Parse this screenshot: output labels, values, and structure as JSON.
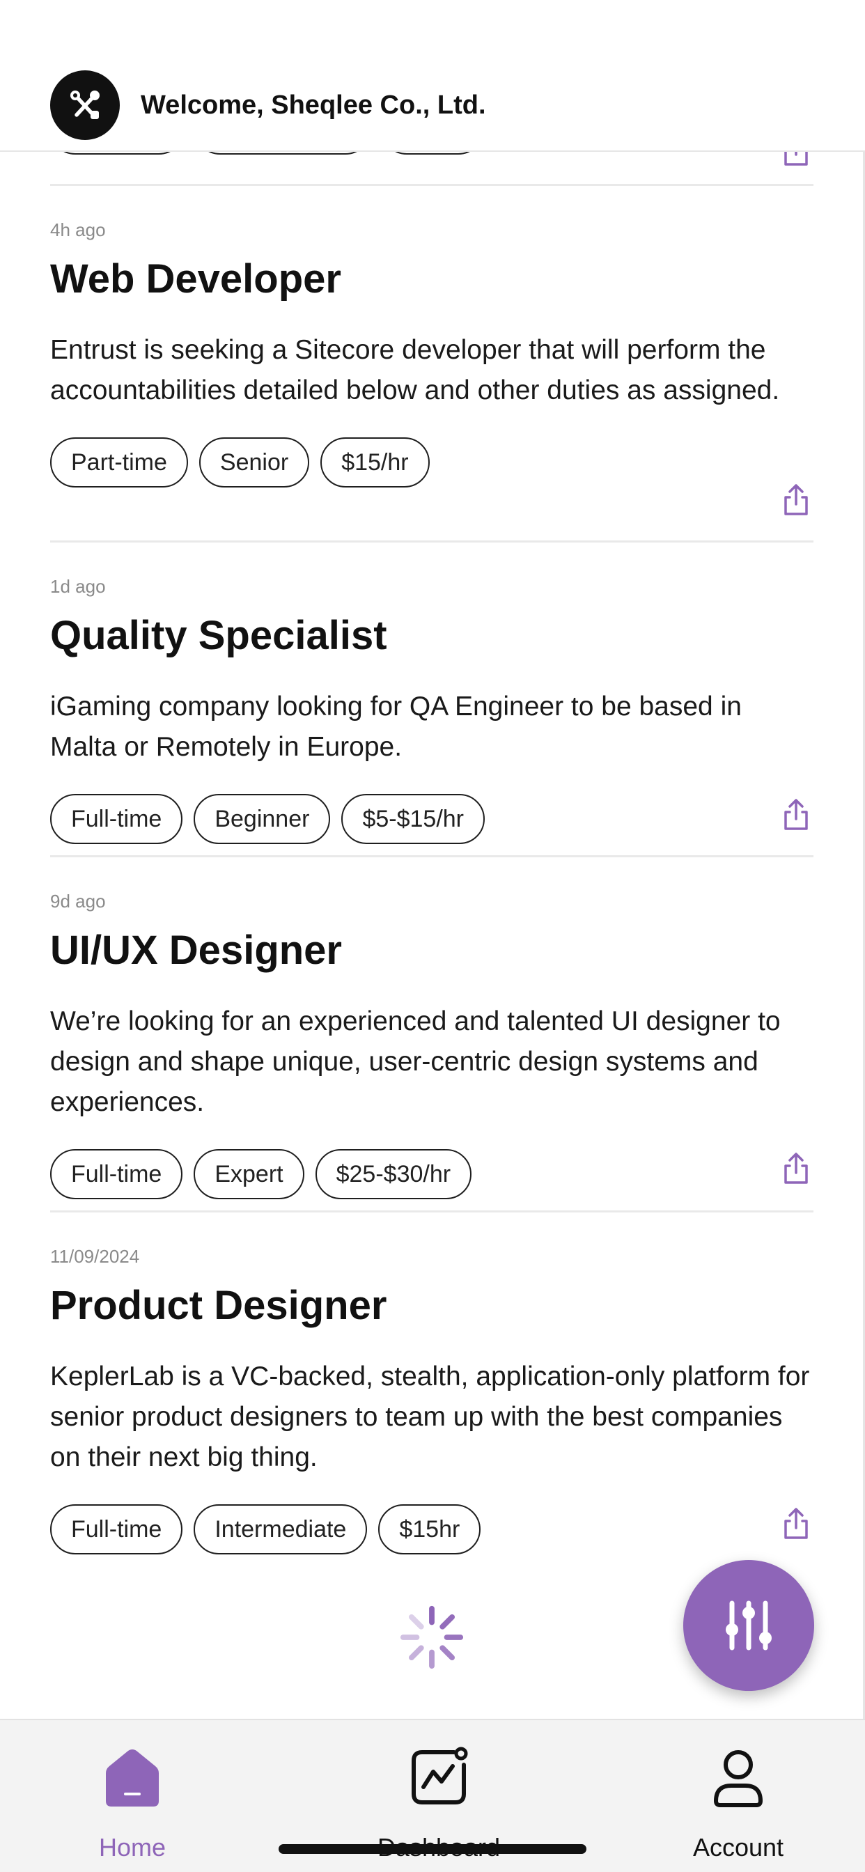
{
  "header": {
    "welcome": "Welcome, Sheqlee Co., Ltd.",
    "logo_icon": "tools-icon"
  },
  "jobs": [
    {
      "time": "4h ago",
      "title": "Web Developer",
      "description": "Entrust is seeking a Sitecore developer that will perform the accountabilities detailed below and other duties as assigned.",
      "tags": [
        "Part-time",
        "Senior",
        "$15/hr"
      ]
    },
    {
      "time": "1d ago",
      "title": "Quality Specialist",
      "description": "iGaming company looking for QA Engineer to be based in Malta or Remotely in Europe.",
      "tags": [
        "Full-time",
        "Beginner",
        "$5-$15/hr"
      ]
    },
    {
      "time": "9d ago",
      "title": "UI/UX Designer",
      "description": "We’re looking for an experienced and talented UI designer to design and shape unique, user-centric design systems and experiences.",
      "tags": [
        "Full-time",
        "Expert",
        "$25-$30/hr"
      ]
    },
    {
      "time": "11/09/2024",
      "title": "Product Designer",
      "description": "KeplerLab is a VC-backed, stealth, application-only platform for senior product designers to team up with the best companies on their next big thing.",
      "tags": [
        "Full-time",
        "Intermediate",
        "$15hr"
      ]
    }
  ],
  "tabs": [
    {
      "label": "Home",
      "icon": "home-icon",
      "active": true
    },
    {
      "label": "Dashboard",
      "icon": "dashboard-icon",
      "active": false
    },
    {
      "label": "Account",
      "icon": "account-icon",
      "active": false
    }
  ],
  "colors": {
    "accent": "#8e65b8",
    "text": "#111111",
    "muted": "#8a8a8a",
    "tabbar_bg": "#f3f3f3"
  }
}
